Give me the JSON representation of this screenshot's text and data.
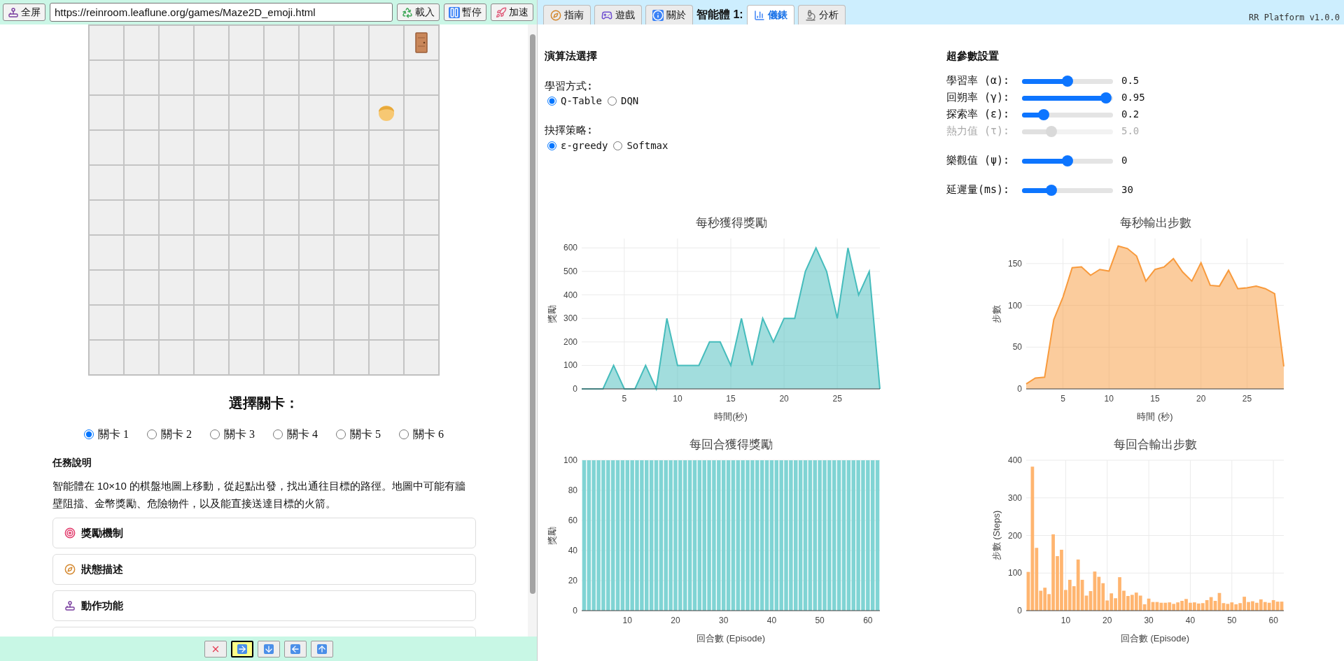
{
  "left": {
    "toolbar": {
      "fullscreen": "全屏",
      "url": "https://reinroom.leaflune.org/games/Maze2D_emoji.html",
      "buttons": [
        "載入",
        "暫停",
        "加速"
      ]
    },
    "maze": {
      "rows": [
        [
          {
            "kind": "empty"
          },
          {
            "kind": "empty"
          },
          {
            "kind": "empty"
          },
          {
            "kind": "empty"
          },
          {
            "kind": "empty"
          },
          {
            "kind": "empty"
          },
          {
            "kind": "empty"
          },
          {
            "kind": "empty"
          },
          {
            "kind": "empty"
          },
          {
            "kind": "door"
          }
        ],
        [
          {
            "kind": "empty"
          },
          {
            "kind": "empty"
          },
          {
            "kind": "empty"
          },
          {
            "kind": "empty"
          },
          {
            "kind": "empty"
          },
          {
            "kind": "empty"
          },
          {
            "kind": "empty"
          },
          {
            "kind": "empty"
          },
          {
            "kind": "empty"
          },
          {
            "kind": "empty"
          }
        ],
        [
          {
            "kind": "empty"
          },
          {
            "kind": "empty"
          },
          {
            "kind": "empty"
          },
          {
            "kind": "empty"
          },
          {
            "kind": "empty"
          },
          {
            "kind": "empty"
          },
          {
            "kind": "empty"
          },
          {
            "kind": "empty"
          },
          {
            "kind": "agent"
          },
          {
            "kind": "empty"
          }
        ],
        [
          {
            "kind": "empty"
          },
          {
            "kind": "empty"
          },
          {
            "kind": "empty"
          },
          {
            "kind": "empty"
          },
          {
            "kind": "empty"
          },
          {
            "kind": "empty"
          },
          {
            "kind": "empty"
          },
          {
            "kind": "empty"
          },
          {
            "kind": "empty"
          },
          {
            "kind": "empty"
          }
        ],
        [
          {
            "kind": "empty"
          },
          {
            "kind": "empty"
          },
          {
            "kind": "empty"
          },
          {
            "kind": "empty"
          },
          {
            "kind": "empty"
          },
          {
            "kind": "empty"
          },
          {
            "kind": "empty"
          },
          {
            "kind": "empty"
          },
          {
            "kind": "empty"
          },
          {
            "kind": "empty"
          }
        ],
        [
          {
            "kind": "empty"
          },
          {
            "kind": "empty"
          },
          {
            "kind": "empty"
          },
          {
            "kind": "empty"
          },
          {
            "kind": "empty"
          },
          {
            "kind": "empty"
          },
          {
            "kind": "empty"
          },
          {
            "kind": "empty"
          },
          {
            "kind": "empty"
          },
          {
            "kind": "empty"
          }
        ],
        [
          {
            "kind": "empty"
          },
          {
            "kind": "empty"
          },
          {
            "kind": "empty"
          },
          {
            "kind": "empty"
          },
          {
            "kind": "empty"
          },
          {
            "kind": "empty"
          },
          {
            "kind": "empty"
          },
          {
            "kind": "empty"
          },
          {
            "kind": "empty"
          },
          {
            "kind": "empty"
          }
        ],
        [
          {
            "kind": "empty"
          },
          {
            "kind": "empty"
          },
          {
            "kind": "empty"
          },
          {
            "kind": "empty"
          },
          {
            "kind": "empty"
          },
          {
            "kind": "empty"
          },
          {
            "kind": "empty"
          },
          {
            "kind": "empty"
          },
          {
            "kind": "empty"
          },
          {
            "kind": "empty"
          }
        ],
        [
          {
            "kind": "empty"
          },
          {
            "kind": "empty"
          },
          {
            "kind": "empty"
          },
          {
            "kind": "empty"
          },
          {
            "kind": "empty"
          },
          {
            "kind": "empty"
          },
          {
            "kind": "empty"
          },
          {
            "kind": "empty"
          },
          {
            "kind": "empty"
          },
          {
            "kind": "empty"
          }
        ],
        [
          {
            "kind": "empty"
          },
          {
            "kind": "empty"
          },
          {
            "kind": "empty"
          },
          {
            "kind": "empty"
          },
          {
            "kind": "empty"
          },
          {
            "kind": "empty"
          },
          {
            "kind": "empty"
          },
          {
            "kind": "empty"
          },
          {
            "kind": "empty"
          },
          {
            "kind": "empty"
          }
        ]
      ]
    },
    "level_select": {
      "title": "選擇關卡：",
      "levels": [
        {
          "label": "關卡 1",
          "selected": true
        },
        {
          "label": "關卡 2",
          "selected": false
        },
        {
          "label": "關卡 3",
          "selected": false
        },
        {
          "label": "關卡 4",
          "selected": false
        },
        {
          "label": "關卡 5",
          "selected": false
        },
        {
          "label": "關卡 6",
          "selected": false
        }
      ]
    },
    "task": {
      "title": "任務說明",
      "text": "智能體在 10×10 的棋盤地圖上移動，從起點出發，找出通往目標的路徑。地圖中可能有牆壁阻擋、金幣獎勵、危險物件，以及能直接送達目標的火箭。"
    },
    "sections": [
      "獎勵機制",
      "狀態描述",
      "動作功能"
    ],
    "controls": [
      {
        "kind": "stop",
        "selected": false
      },
      {
        "kind": "right",
        "selected": true
      },
      {
        "kind": "down",
        "selected": false
      },
      {
        "kind": "left",
        "selected": false
      },
      {
        "kind": "up",
        "selected": false
      }
    ]
  },
  "right": {
    "tabs": [
      {
        "label": "指南",
        "selected": false
      },
      {
        "label": "遊戲",
        "selected": false
      },
      {
        "label": "關於",
        "selected": false
      }
    ],
    "agent_label": "智能體 1:",
    "agent_tabs": [
      {
        "label": "儀錶",
        "selected": true
      },
      {
        "label": "分析",
        "selected": false
      }
    ],
    "version": "RR Platform v1.0.0",
    "algorithm": {
      "title": "演算法選擇",
      "groups": [
        {
          "label": "學習方式:",
          "options": [
            {
              "label": "Q-Table",
              "selected": true
            },
            {
              "label": "DQN",
              "selected": false
            }
          ]
        },
        {
          "label": "抉擇策略:",
          "options": [
            {
              "label": "ε-greedy",
              "selected": true
            },
            {
              "label": "Softmax",
              "selected": false
            }
          ]
        }
      ]
    },
    "hyperparameters": {
      "title": "超參數設置",
      "groups": [
        [
          {
            "label": "學習率 (α):",
            "level": 0.5,
            "reading": "0.5",
            "disabled": false
          },
          {
            "label": "回朔率 (γ):",
            "level": 0.98,
            "reading": "0.95",
            "disabled": false
          },
          {
            "label": "探索率 (ε):",
            "level": 0.2,
            "reading": "0.2",
            "disabled": false
          },
          {
            "label": "熱力值 (τ):",
            "level": 0.3,
            "reading": "5.0",
            "disabled": true
          }
        ],
        [
          {
            "label": "樂觀值 (ψ):",
            "level": 0.5,
            "reading": "0",
            "disabled": false
          }
        ],
        [
          {
            "label": "延遲量(ms):",
            "level": 0.3,
            "reading": "30",
            "disabled": false
          }
        ]
      ]
    },
    "charts": [
      {
        "chart_data": {
          "type": "area",
          "title": "每秒獲得獎勵",
          "xlabel": "時間(秒)",
          "ylabel": "獎勵",
          "x": [
            1,
            2,
            3,
            4,
            5,
            6,
            7,
            8,
            9,
            10,
            11,
            12,
            13,
            14,
            15,
            16,
            17,
            18,
            19,
            20,
            21,
            22,
            23,
            24,
            25,
            26,
            27,
            28,
            29
          ],
          "series": [
            {
              "color": "#45bcbc",
              "values": [
                0,
                0,
                0,
                100,
                0,
                0,
                100,
                0,
                300,
                100,
                100,
                100,
                200,
                200,
                100,
                300,
                100,
                300,
                200,
                300,
                300,
                500,
                600,
                500,
                300,
                600,
                400,
                500,
                0
              ]
            }
          ],
          "xlim": [
            1,
            29
          ],
          "ylim": [
            0,
            640
          ],
          "xticks": [
            5,
            10,
            15,
            20,
            25
          ],
          "yticks": [
            0,
            100,
            200,
            300,
            400,
            500,
            600
          ],
          "grid": true
        }
      },
      {
        "chart_data": {
          "type": "area",
          "title": "每秒輸出步數",
          "xlabel": "時間 (秒)",
          "ylabel": "步數",
          "x": [
            1,
            2,
            3,
            4,
            5,
            6,
            7,
            8,
            9,
            10,
            11,
            12,
            13,
            14,
            15,
            16,
            17,
            18,
            19,
            20,
            21,
            22,
            23,
            24,
            25,
            26,
            27,
            28,
            29
          ],
          "series": [
            {
              "color": "#f89a3c",
              "values": [
                6,
                13,
                14,
                83,
                110,
                145,
                146,
                136,
                143,
                141,
                171,
                168,
                159,
                129,
                143,
                146,
                156,
                140,
                129,
                151,
                124,
                123,
                142,
                120,
                121,
                123,
                120,
                114,
                27
              ]
            }
          ],
          "xlim": [
            1,
            29
          ],
          "ylim": [
            0,
            180
          ],
          "xticks": [
            5,
            10,
            15,
            20,
            25
          ],
          "yticks": [
            0,
            50,
            100,
            150
          ],
          "grid": true
        }
      },
      {
        "chart_data": {
          "type": "bar",
          "title": "每回合獲得獎勵",
          "xlabel": "回合數 (Episode)",
          "ylabel": "獎勵",
          "x": [
            1,
            2,
            3,
            4,
            5,
            6,
            7,
            8,
            9,
            10,
            11,
            12,
            13,
            14,
            15,
            16,
            17,
            18,
            19,
            20,
            21,
            22,
            23,
            24,
            25,
            26,
            27,
            28,
            29,
            30,
            31,
            32,
            33,
            34,
            35,
            36,
            37,
            38,
            39,
            40,
            41,
            42,
            43,
            44,
            45,
            46,
            47,
            48,
            49,
            50,
            51,
            52,
            53,
            54,
            55,
            56,
            57,
            58,
            59,
            60,
            61,
            62
          ],
          "series": [
            {
              "color": "#80d4d4",
              "values": [
                100,
                100,
                100,
                100,
                100,
                100,
                100,
                100,
                100,
                100,
                100,
                100,
                100,
                100,
                100,
                100,
                100,
                100,
                100,
                100,
                100,
                100,
                100,
                100,
                100,
                100,
                100,
                100,
                100,
                100,
                100,
                100,
                100,
                100,
                100,
                100,
                100,
                100,
                100,
                100,
                100,
                100,
                100,
                100,
                100,
                100,
                100,
                100,
                100,
                100,
                100,
                100,
                100,
                100,
                100,
                100,
                100,
                100,
                100,
                100,
                100,
                100
              ]
            }
          ],
          "xlim": [
            0.5,
            62.5
          ],
          "ylim": [
            0,
            100
          ],
          "xticks": [
            10,
            20,
            30,
            40,
            50,
            60
          ],
          "yticks": [
            0,
            20,
            40,
            60,
            80,
            100
          ],
          "grid": true
        }
      },
      {
        "chart_data": {
          "type": "bar",
          "title": "每回合輸出步數",
          "xlabel": "回合數 (Episode)",
          "ylabel": "步數 (Steps)",
          "x": [
            1,
            2,
            3,
            4,
            5,
            6,
            7,
            8,
            9,
            10,
            11,
            12,
            13,
            14,
            15,
            16,
            17,
            18,
            19,
            20,
            21,
            22,
            23,
            24,
            25,
            26,
            27,
            28,
            29,
            30,
            31,
            32,
            33,
            34,
            35,
            36,
            37,
            38,
            39,
            40,
            41,
            42,
            43,
            44,
            45,
            46,
            47,
            48,
            49,
            50,
            51,
            52,
            53,
            54,
            55,
            56,
            57,
            58,
            59,
            60,
            61,
            62
          ],
          "series": [
            {
              "color": "#ffb570",
              "values": [
                103,
                383,
                167,
                53,
                61,
                44,
                203,
                145,
                162,
                55,
                82,
                65,
                136,
                82,
                40,
                52,
                104,
                90,
                73,
                27,
                46,
                33,
                89,
                53,
                39,
                42,
                48,
                40,
                17,
                32,
                23,
                23,
                21,
                21,
                22,
                18,
                22,
                26,
                31,
                21,
                22,
                19,
                20,
                28,
                36,
                26,
                47,
                20,
                18,
                22,
                17,
                20,
                37,
                23,
                25,
                21,
                30,
                23,
                21,
                28,
                24,
                24
              ]
            }
          ],
          "xlim": [
            0.5,
            62.5
          ],
          "ylim": [
            0,
            400
          ],
          "xticks": [
            10,
            20,
            30,
            40,
            50,
            60
          ],
          "yticks": [
            0,
            100,
            200,
            300,
            400
          ],
          "grid": true
        }
      }
    ]
  }
}
